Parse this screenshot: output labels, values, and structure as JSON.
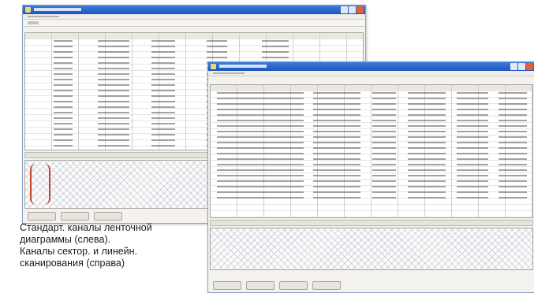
{
  "caption": {
    "lines": [
      "Стандарт. каналы ленточной",
      "диаграммы (слева).",
      "Каналы сектор. и линейн.",
      "сканирования (справа)"
    ]
  },
  "colors": {
    "titlebar": "#1f55b8",
    "window_bg": "#f3f2ee",
    "trace": "#c2412f"
  },
  "icons": {
    "app": "app-icon",
    "minimize": "minimize-icon",
    "maximize": "maximize-icon",
    "close": "close-icon"
  }
}
